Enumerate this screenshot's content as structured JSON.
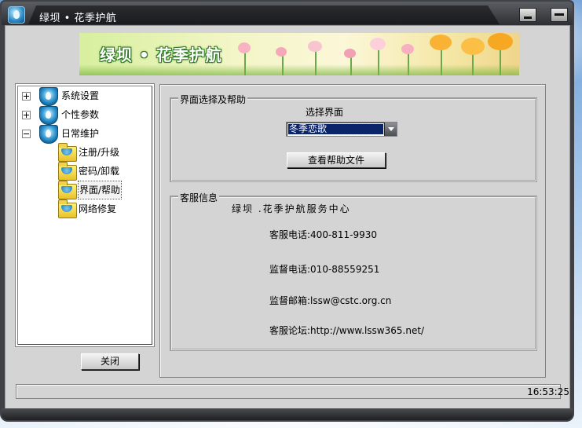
{
  "window": {
    "title": "绿坝 • 花季护航",
    "minimize_icon": "minimize-icon",
    "close_icon": "close-icon"
  },
  "banner": {
    "title": "绿坝 • 花季护航"
  },
  "tree": {
    "items": [
      {
        "label": "系统设置",
        "expander": "plus",
        "icon": "shield-icon"
      },
      {
        "label": "个性参数",
        "expander": "plus",
        "icon": "shield-icon"
      },
      {
        "label": "日常维护",
        "expander": "minus",
        "icon": "shield-icon"
      },
      {
        "label": "注册/升级",
        "icon": "folder-icon"
      },
      {
        "label": "密码/卸载",
        "icon": "folder-icon"
      },
      {
        "label": "界面/帮助",
        "icon": "folder-icon",
        "selected": true
      },
      {
        "label": "网络修复",
        "icon": "folder-icon"
      }
    ]
  },
  "buttons": {
    "close": "关闭",
    "view_help": "查看帮助文件"
  },
  "interface_group": {
    "title": "界面选择及帮助",
    "select_label": "选择界面",
    "select_value": "冬季恋歌"
  },
  "service_group": {
    "title": "客服信息",
    "center_name": "绿坝 .花季护航服务中心",
    "phone": "客服电话:400-811-9930",
    "supervise_phone": "监督电话:010-88559251",
    "supervise_email": "监督邮箱:lssw@cstc.org.cn",
    "forum": "客服论坛:http://www.lssw365.net/"
  },
  "status": {
    "time": "16:53:25"
  },
  "colors": {
    "title_bar": "#2d2f33",
    "client_bg": "#d4d4d4",
    "selection": "#0a246a"
  }
}
